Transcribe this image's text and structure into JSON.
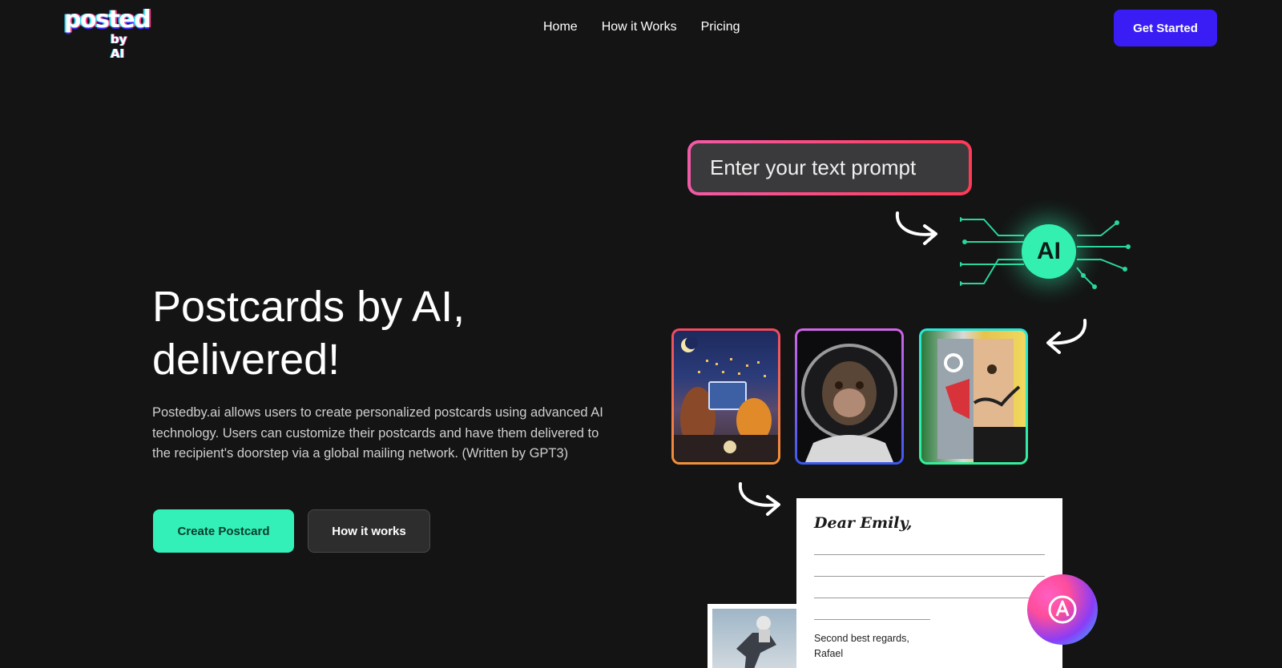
{
  "brand": {
    "logo_word": "posted",
    "logo_by": "by AI"
  },
  "nav": {
    "items": [
      "Home",
      "How it Works",
      "Pricing"
    ]
  },
  "header": {
    "cta_label": "Get Started"
  },
  "hero": {
    "title_line1": "Postcards by AI,",
    "title_line2": "delivered!",
    "description": "Postedby.ai allows users to create personalized postcards using advanced AI technology. Users can customize their postcards and have them delivered to the recipient's doorstep via a global mailing network. (Written by GPT3)",
    "primary_button": "Create Postcard",
    "secondary_button": "How it works"
  },
  "illustration": {
    "prompt_text": "Enter your text prompt",
    "ai_label": "AI",
    "letter_greeting": "Dear Emily,",
    "letter_signoff_line1": "Second best regards,",
    "letter_signoff_line2": "Rafael"
  },
  "colors": {
    "background": "#141414",
    "accent_purple": "#3a1df5",
    "accent_green": "#33f0b8",
    "prompt_gradient_start": "#f25aa6",
    "prompt_gradient_end": "#ff3a55"
  },
  "icons": [
    "curved-arrow-icon",
    "circuit-icon",
    "ai-orb-icon"
  ]
}
